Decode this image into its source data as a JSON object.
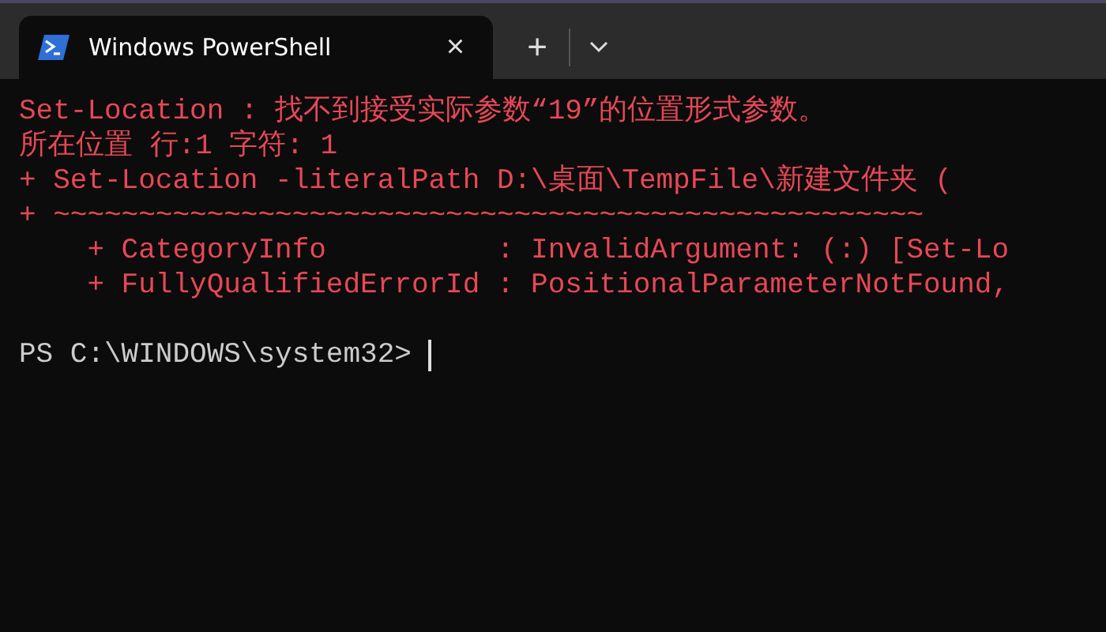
{
  "tabs": [
    {
      "title": "Windows PowerShell",
      "selected": true,
      "close": "×"
    }
  ],
  "new_tab": "+",
  "output": [
    {
      "text": "Set-Location : 找不到接受实际参数“19”的位置形式参数。",
      "kind": "error"
    },
    {
      "text": "所在位置 行:1 字符: 1",
      "kind": "error"
    },
    {
      "text": "+ Set-Location -literalPath D:\\桌面\\TempFile\\新建文件夹 (",
      "kind": "error"
    },
    {
      "text": "+ ~~~~~~~~~~~~~~~~~~~~~~~~~~~~~~~~~~~~~~~~~~~~~~~~~~~",
      "kind": "error"
    },
    {
      "text": "    + CategoryInfo          : InvalidArgument: (:) [Set-Lo",
      "kind": "error"
    },
    {
      "text": "    + FullyQualifiedErrorId : PositionalParameterNotFound,",
      "kind": "error"
    },
    {
      "kind": "blank"
    },
    {
      "text": "PS C:\\WINDOWS\\system32> ",
      "kind": "prompt"
    }
  ]
}
